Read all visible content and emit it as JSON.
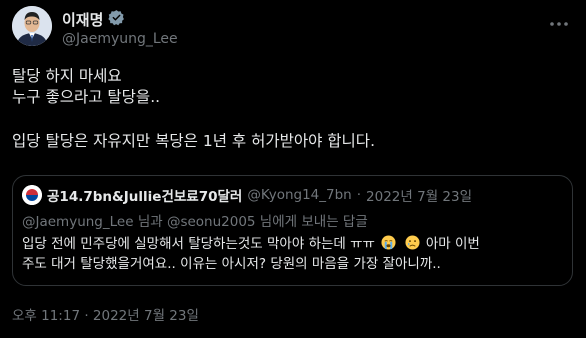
{
  "author": {
    "name": "이재명",
    "handle": "@Jaemyung_Lee"
  },
  "tweet": {
    "line1": "탈당 하지 마세요",
    "line2": "누구 좋으라고 탈당을..",
    "line3": "입당 탈당은 자유지만 복당은 1년 후 허가받아야 합니다."
  },
  "quote": {
    "name": "공14.7bn&Jullie건보료70달러",
    "handle": "@Kyong14_7bn",
    "separator": "·",
    "date": "2022년 7월 23일",
    "reply_prefix": "@Jaemyung_Lee 님과 @seonu2005 님에게 보내는 답글",
    "body_part1": "입당 전에 민주당에 실망해서 탈당하는것도 막아야 하는데 ㅠㅠ",
    "body_part2": "아마 이번",
    "body_line2": "주도 대거 탈당했을거여요.. 이유는 아시저? 당원의 마음을 가장 잘아니까..",
    "emojis": [
      "crying-face",
      "sad-face"
    ]
  },
  "timestamp": "오후 11:17 · 2022년 7월 23일",
  "colors": {
    "background": "#000000",
    "text": "#e7e9ea",
    "muted": "#71767b",
    "border": "#2f3336",
    "verified_badge": "#829aab"
  },
  "icons": {
    "verified": "verified-badge-icon",
    "more": "more-options-icon"
  }
}
